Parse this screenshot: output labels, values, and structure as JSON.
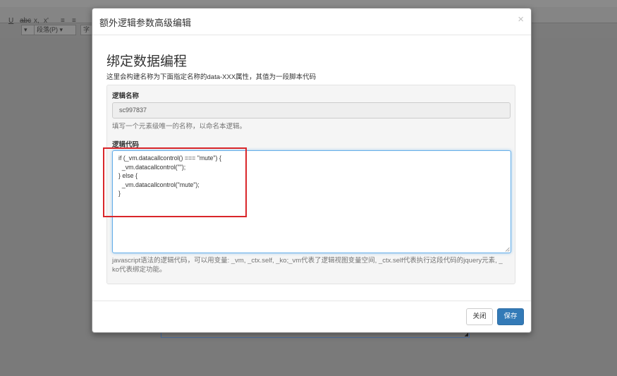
{
  "background": {
    "toolbar_tools": [
      "U",
      "abc",
      "x,",
      "x'",
      "≡",
      "≡"
    ],
    "paragraph_select": "段落(P)",
    "font_select": "字"
  },
  "dialog": {
    "title": "额外逻辑参数高级编辑",
    "close_symbol": "×",
    "heading": "绑定数据编程",
    "description": "这里会构建名称为下面指定名称的data-XXX属性，其值为一段脚本代码",
    "name_field": {
      "label": "逻辑名称",
      "value": "sc997837",
      "help": "填写一个元素级唯一的名称，以命名本逻辑。"
    },
    "code_field": {
      "label": "逻辑代码",
      "lines": [
        "if (_vm.datacallcontrol() === \"mute\") {",
        "  _vm.datacallcontrol(\"\");",
        "} else {",
        "  _vm.datacallcontrol(\"mute\");",
        "}"
      ],
      "help_line1": "javascript语法的逻辑代码，可以用变量: _vm, _ctx.self, _ko;_vm代表了逻辑视图变量空间, _ctx.self代表执行这段代码的jquery元素, _",
      "help_line2": "ko代表绑定功能。"
    },
    "footer": {
      "close_label": "关闭",
      "save_label": "保存"
    }
  },
  "colors": {
    "primary": "#337ab7",
    "annotation": "#d9262a",
    "focus_border": "#66afe9"
  }
}
